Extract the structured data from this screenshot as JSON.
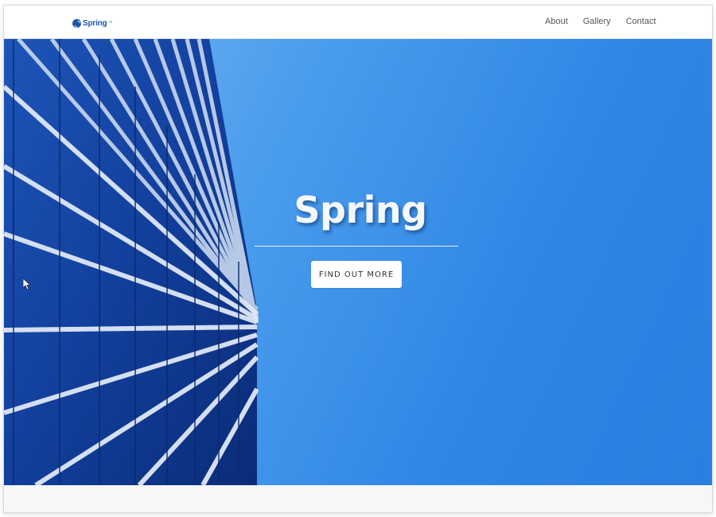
{
  "navbar": {
    "brand": {
      "name": "Spring",
      "tm": "™",
      "icon": "spring-logo-icon"
    },
    "links": [
      {
        "label": "About"
      },
      {
        "label": "Gallery"
      },
      {
        "label": "Contact"
      }
    ]
  },
  "hero": {
    "title": "Spring",
    "button_label": "FIND OUT MORE",
    "background_image": "building-facade-sky"
  },
  "colors": {
    "brand": "#1b56a8",
    "sky": "#2f86e4",
    "text_light": "#f4f8fc"
  }
}
